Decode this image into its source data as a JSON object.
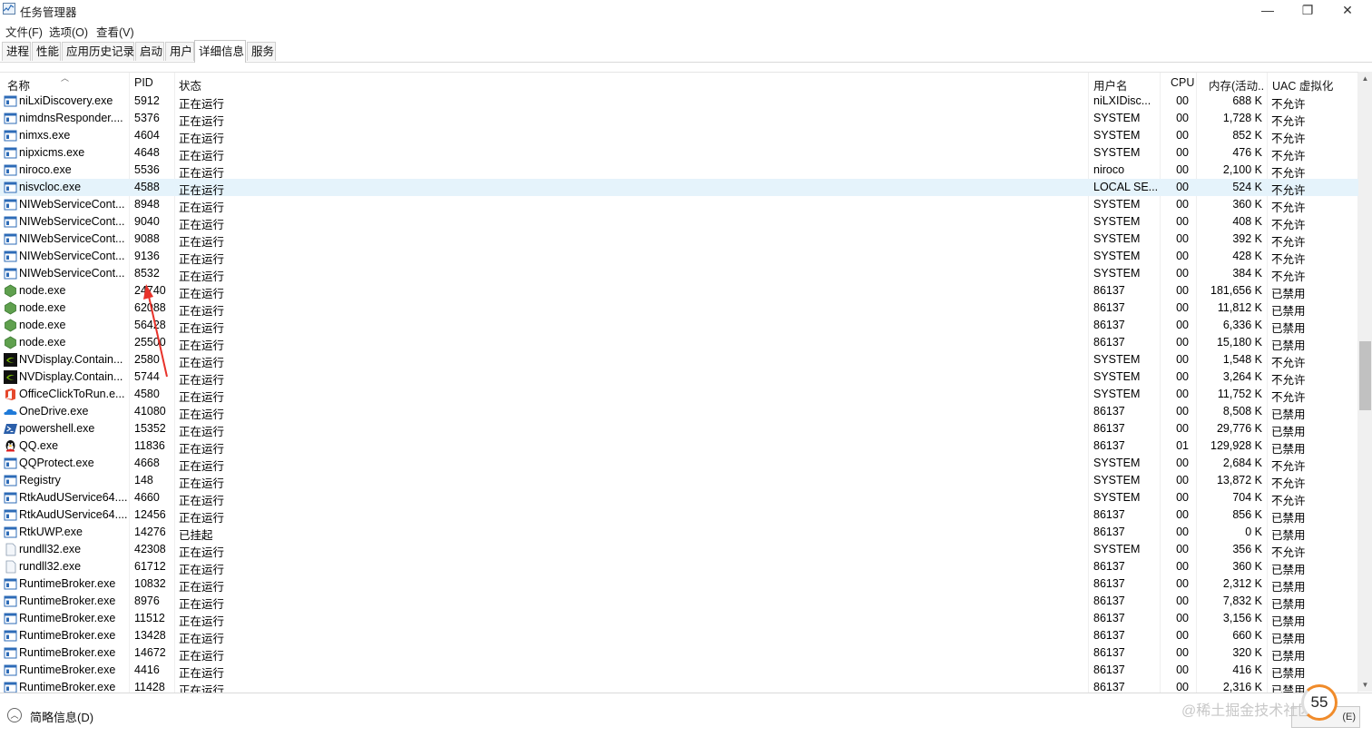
{
  "window": {
    "title": "任务管理器",
    "minimize": "—",
    "maximize": "❐",
    "close": "✕"
  },
  "menu": [
    "文件(F)",
    "选项(O)",
    "查看(V)"
  ],
  "tabs": [
    {
      "label": "进程",
      "active": false
    },
    {
      "label": "性能",
      "active": false
    },
    {
      "label": "应用历史记录",
      "active": false
    },
    {
      "label": "启动",
      "active": false
    },
    {
      "label": "用户",
      "active": false
    },
    {
      "label": "详细信息",
      "active": true
    },
    {
      "label": "服务",
      "active": false
    }
  ],
  "columns": {
    "name": "名称",
    "pid": "PID",
    "status": "状态",
    "user": "用户名",
    "cpu": "CPU",
    "memory": "内存(活动...",
    "uac": "UAC 虚拟化"
  },
  "selected_row": 5,
  "rows": [
    {
      "icon": "app-window-icon",
      "name": "niLxiDiscovery.exe",
      "pid": "5912",
      "status": "正在运行",
      "user": "niLXIDisc...",
      "cpu": "00",
      "mem": "688 K",
      "uac": "不允许"
    },
    {
      "icon": "app-window-icon",
      "name": "nimdnsResponder....",
      "pid": "5376",
      "status": "正在运行",
      "user": "SYSTEM",
      "cpu": "00",
      "mem": "1,728 K",
      "uac": "不允许"
    },
    {
      "icon": "app-window-icon",
      "name": "nimxs.exe",
      "pid": "4604",
      "status": "正在运行",
      "user": "SYSTEM",
      "cpu": "00",
      "mem": "852 K",
      "uac": "不允许"
    },
    {
      "icon": "app-window-icon",
      "name": "nipxicms.exe",
      "pid": "4648",
      "status": "正在运行",
      "user": "SYSTEM",
      "cpu": "00",
      "mem": "476 K",
      "uac": "不允许"
    },
    {
      "icon": "app-window-icon",
      "name": "niroco.exe",
      "pid": "5536",
      "status": "正在运行",
      "user": "niroco",
      "cpu": "00",
      "mem": "2,100 K",
      "uac": "不允许"
    },
    {
      "icon": "app-window-icon",
      "name": "nisvcloc.exe",
      "pid": "4588",
      "status": "正在运行",
      "user": "LOCAL SE...",
      "cpu": "00",
      "mem": "524 K",
      "uac": "不允许"
    },
    {
      "icon": "app-window-icon",
      "name": "NIWebServiceCont...",
      "pid": "8948",
      "status": "正在运行",
      "user": "SYSTEM",
      "cpu": "00",
      "mem": "360 K",
      "uac": "不允许"
    },
    {
      "icon": "app-window-icon",
      "name": "NIWebServiceCont...",
      "pid": "9040",
      "status": "正在运行",
      "user": "SYSTEM",
      "cpu": "00",
      "mem": "408 K",
      "uac": "不允许"
    },
    {
      "icon": "app-window-icon",
      "name": "NIWebServiceCont...",
      "pid": "9088",
      "status": "正在运行",
      "user": "SYSTEM",
      "cpu": "00",
      "mem": "392 K",
      "uac": "不允许"
    },
    {
      "icon": "app-window-icon",
      "name": "NIWebServiceCont...",
      "pid": "9136",
      "status": "正在运行",
      "user": "SYSTEM",
      "cpu": "00",
      "mem": "428 K",
      "uac": "不允许"
    },
    {
      "icon": "app-window-icon",
      "name": "NIWebServiceCont...",
      "pid": "8532",
      "status": "正在运行",
      "user": "SYSTEM",
      "cpu": "00",
      "mem": "384 K",
      "uac": "不允许"
    },
    {
      "icon": "nodejs-icon",
      "name": "node.exe",
      "pid": "24740",
      "status": "正在运行",
      "user": "86137",
      "cpu": "00",
      "mem": "181,656 K",
      "uac": "已禁用"
    },
    {
      "icon": "nodejs-icon",
      "name": "node.exe",
      "pid": "62088",
      "status": "正在运行",
      "user": "86137",
      "cpu": "00",
      "mem": "11,812 K",
      "uac": "已禁用"
    },
    {
      "icon": "nodejs-icon",
      "name": "node.exe",
      "pid": "56428",
      "status": "正在运行",
      "user": "86137",
      "cpu": "00",
      "mem": "6,336 K",
      "uac": "已禁用"
    },
    {
      "icon": "nodejs-icon",
      "name": "node.exe",
      "pid": "25500",
      "status": "正在运行",
      "user": "86137",
      "cpu": "00",
      "mem": "15,180 K",
      "uac": "已禁用"
    },
    {
      "icon": "nvidia-icon",
      "name": "NVDisplay.Contain...",
      "pid": "2580",
      "status": "正在运行",
      "user": "SYSTEM",
      "cpu": "00",
      "mem": "1,548 K",
      "uac": "不允许"
    },
    {
      "icon": "nvidia-icon",
      "name": "NVDisplay.Contain...",
      "pid": "5744",
      "status": "正在运行",
      "user": "SYSTEM",
      "cpu": "00",
      "mem": "3,264 K",
      "uac": "不允许"
    },
    {
      "icon": "office-icon",
      "name": "OfficeClickToRun.e...",
      "pid": "4580",
      "status": "正在运行",
      "user": "SYSTEM",
      "cpu": "00",
      "mem": "11,752 K",
      "uac": "不允许"
    },
    {
      "icon": "onedrive-cloud-icon",
      "name": "OneDrive.exe",
      "pid": "41080",
      "status": "正在运行",
      "user": "86137",
      "cpu": "00",
      "mem": "8,508 K",
      "uac": "已禁用"
    },
    {
      "icon": "powershell-icon",
      "name": "powershell.exe",
      "pid": "15352",
      "status": "正在运行",
      "user": "86137",
      "cpu": "00",
      "mem": "29,776 K",
      "uac": "已禁用"
    },
    {
      "icon": "qq-penguin-icon",
      "name": "QQ.exe",
      "pid": "11836",
      "status": "正在运行",
      "user": "86137",
      "cpu": "01",
      "mem": "129,928 K",
      "uac": "已禁用"
    },
    {
      "icon": "app-window-icon",
      "name": "QQProtect.exe",
      "pid": "4668",
      "status": "正在运行",
      "user": "SYSTEM",
      "cpu": "00",
      "mem": "2,684 K",
      "uac": "不允许"
    },
    {
      "icon": "app-window-icon",
      "name": "Registry",
      "pid": "148",
      "status": "正在运行",
      "user": "SYSTEM",
      "cpu": "00",
      "mem": "13,872 K",
      "uac": "不允许"
    },
    {
      "icon": "app-window-icon",
      "name": "RtkAudUService64....",
      "pid": "4660",
      "status": "正在运行",
      "user": "SYSTEM",
      "cpu": "00",
      "mem": "704 K",
      "uac": "不允许"
    },
    {
      "icon": "app-window-icon",
      "name": "RtkAudUService64....",
      "pid": "12456",
      "status": "正在运行",
      "user": "86137",
      "cpu": "00",
      "mem": "856 K",
      "uac": "已禁用"
    },
    {
      "icon": "app-window-icon",
      "name": "RtkUWP.exe",
      "pid": "14276",
      "status": "已挂起",
      "user": "86137",
      "cpu": "00",
      "mem": "0 K",
      "uac": "已禁用"
    },
    {
      "icon": "blank-file-icon",
      "name": "rundll32.exe",
      "pid": "42308",
      "status": "正在运行",
      "user": "SYSTEM",
      "cpu": "00",
      "mem": "356 K",
      "uac": "不允许"
    },
    {
      "icon": "blank-file-icon",
      "name": "rundll32.exe",
      "pid": "61712",
      "status": "正在运行",
      "user": "86137",
      "cpu": "00",
      "mem": "360 K",
      "uac": "已禁用"
    },
    {
      "icon": "app-window-icon",
      "name": "RuntimeBroker.exe",
      "pid": "10832",
      "status": "正在运行",
      "user": "86137",
      "cpu": "00",
      "mem": "2,312 K",
      "uac": "已禁用"
    },
    {
      "icon": "app-window-icon",
      "name": "RuntimeBroker.exe",
      "pid": "8976",
      "status": "正在运行",
      "user": "86137",
      "cpu": "00",
      "mem": "7,832 K",
      "uac": "已禁用"
    },
    {
      "icon": "app-window-icon",
      "name": "RuntimeBroker.exe",
      "pid": "11512",
      "status": "正在运行",
      "user": "86137",
      "cpu": "00",
      "mem": "3,156 K",
      "uac": "已禁用"
    },
    {
      "icon": "app-window-icon",
      "name": "RuntimeBroker.exe",
      "pid": "13428",
      "status": "正在运行",
      "user": "86137",
      "cpu": "00",
      "mem": "660 K",
      "uac": "已禁用"
    },
    {
      "icon": "app-window-icon",
      "name": "RuntimeBroker.exe",
      "pid": "14672",
      "status": "正在运行",
      "user": "86137",
      "cpu": "00",
      "mem": "320 K",
      "uac": "已禁用"
    },
    {
      "icon": "app-window-icon",
      "name": "RuntimeBroker.exe",
      "pid": "4416",
      "status": "正在运行",
      "user": "86137",
      "cpu": "00",
      "mem": "416 K",
      "uac": "已禁用"
    },
    {
      "icon": "app-window-icon",
      "name": "RuntimeBroker.exe",
      "pid": "11428",
      "status": "正在运行",
      "user": "86137",
      "cpu": "00",
      "mem": "2,316 K",
      "uac": "已禁用"
    }
  ],
  "footer": {
    "fewer_details": "简略信息(D)",
    "end_task": "(E)",
    "watermark": "@稀土掘金技术社区",
    "badge": "55"
  },
  "annotation": {
    "color": "#e8322a"
  }
}
